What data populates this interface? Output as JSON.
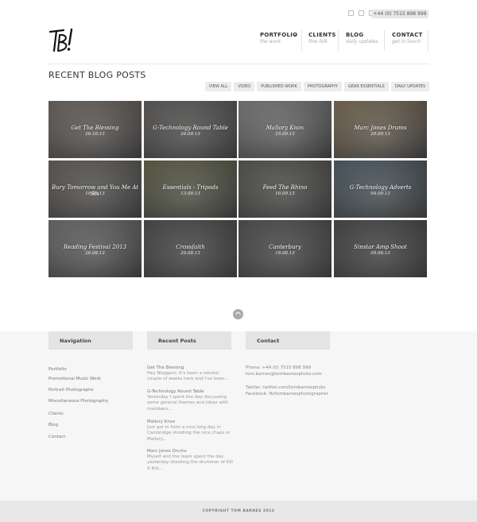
{
  "header": {
    "phone": "+44 (0) 7515 898 999",
    "social": [
      "twitter-icon",
      "facebook-icon",
      "instagram-icon"
    ],
    "logo_text": "TB!"
  },
  "nav": [
    {
      "title": "PORTFOLIO",
      "subtitle": "the work"
    },
    {
      "title": "CLIENTS",
      "subtitle": "fine folk"
    },
    {
      "title": "BLOG",
      "subtitle": "daily updates"
    },
    {
      "title": "CONTACT",
      "subtitle": "get in touch"
    }
  ],
  "blog": {
    "heading": "RECENT BLOG POSTS",
    "filters": [
      "VIEW ALL",
      "VIDEO",
      "PUBLISHED WORK",
      "PHOTOGRAPHY",
      "GEAR ESSENTIALS",
      "DAILY UPDATES"
    ],
    "posts": [
      {
        "title": "Get The Blessing",
        "date": "26.10.13",
        "tone": "#7b746e"
      },
      {
        "title": "G-Technology Round Table",
        "date": "26.09.13",
        "tone": "#6c6a68"
      },
      {
        "title": "Mallory Knox",
        "date": "25.09.13",
        "tone": "#8b8c8c"
      },
      {
        "title": "Marc Jones Drums",
        "date": "20.09.13",
        "tone": "#8a7a62"
      },
      {
        "title": "Bury Tomorrow and You Me At Six",
        "date": "19.09.13",
        "tone": "#6f6c68"
      },
      {
        "title": "Essentials - Tripods",
        "date": "13.09.13",
        "tone": "#6d6e55"
      },
      {
        "title": "Feed The Rhino",
        "date": "10.09.13",
        "tone": "#63635f"
      },
      {
        "title": "G-Technology Adverts",
        "date": "04.09.13",
        "tone": "#5b6a74"
      },
      {
        "title": "Reading Festival 2013",
        "date": "26.08.13",
        "tone": "#7c7c7c"
      },
      {
        "title": "Crossfaith",
        "date": "20.08.13",
        "tone": "#585858"
      },
      {
        "title": "Canterbury",
        "date": "18.08.13",
        "tone": "#5d5d5d"
      },
      {
        "title": "Sinstar Amp Shoot",
        "date": "09.08.13",
        "tone": "#545454"
      }
    ]
  },
  "footer": {
    "nav_heading": "Navigation",
    "nav_links": [
      "Portfolio",
      "Promotional Music Work",
      "Portrait Photographs",
      "Miscellaneous Photography",
      "Clients",
      "Blog",
      "Contact"
    ],
    "posts_heading": "Recent Posts",
    "recent_posts": [
      {
        "title": "Get The Blessing",
        "excerpt": "Hey Bloggers, It's been a mental couple of weeks here and I've been..."
      },
      {
        "title": "G-Technology Round Table",
        "excerpt": "Yesterday I spent the day discussing some general themes and ideas with members..."
      },
      {
        "title": "Mallory Knox",
        "excerpt": "Just got in from a nice long day in Cambridge shooting the nice chaps in Mallory..."
      },
      {
        "title": "Marc Jones Drums",
        "excerpt": "Myself and the team spent the day yesterday shooting the drummer of Kill It Kid..."
      }
    ],
    "contact_heading": "Contact",
    "contact": {
      "phone": "Phone: +44 (0) 7515 898 999",
      "email": "tom.barnes@tombarnesphoto.com",
      "twitter": "Twitter: twitter.com/tombarnesphoto",
      "facebook": "Facebook: fb/tombarnesphotographer"
    }
  },
  "copyright": "COPYRIGHT TOM BARNES 2013"
}
